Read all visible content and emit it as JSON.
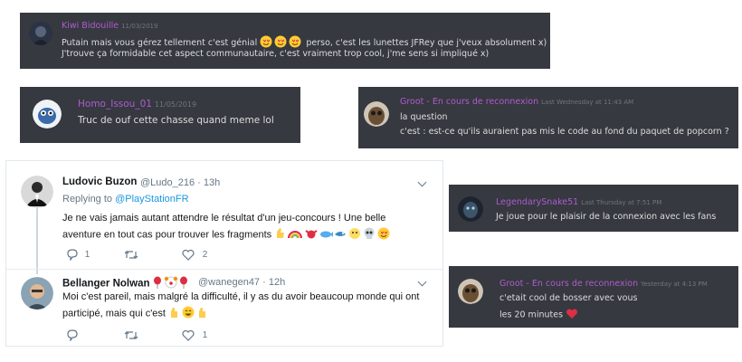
{
  "discord": {
    "kiwi": {
      "username": "Kiwi Bidouille",
      "timestamp": "11/03/2019",
      "line1_a": "Putain mais vous gérez tellement c'est génial",
      "line1_b": "perso, c'est les lunettes JFRey que j'veux absolument x)",
      "line2": "J'trouve ça formidable cet aspect communautaire, c'est vraiment trop cool, j'me sens si impliqué x)"
    },
    "homo": {
      "username": "Homo_Issou_01",
      "timestamp": "11/05/2019",
      "line1": "Truc de ouf cette chasse quand meme lol"
    },
    "groot1": {
      "username": "Groot - En cours de reconnexion",
      "timestamp": "Last Wednesday at 11:43 AM",
      "line1": "la question",
      "line2": "c'est : est-ce qu'ils auraient pas mis le code au fond du paquet de popcorn ?"
    },
    "legendary": {
      "username": "LegendarySnake51",
      "timestamp": "Last Thursday at 7:51 PM",
      "line1": "Je joue pour le plaisir de la connexion avec les fans"
    },
    "groot2": {
      "username": "Groot - En cours de reconnexion",
      "timestamp": "Yesterday at 4:13 PM",
      "line1": "c'etait cool de bosser avec vous",
      "line2": "les 20 minutes"
    }
  },
  "twitter": {
    "tweet1": {
      "name": "Ludovic Buzon",
      "handle": "@Ludo_216 · 13h",
      "replying_prefix": "Replying to",
      "replying_to": "@PlayStationFR",
      "line1": "Je ne vais jamais autant attendre le résultat d'un jeu-concours ! Une belle",
      "line2": "aventure en tout cas pour trouver les fragments",
      "reply_count": "1",
      "retweet_count": "",
      "like_count": "2"
    },
    "tweet2": {
      "name": "Bellanger Nolwan",
      "handle": "@wanegen47 · 12h",
      "line1": "Moi c'est pareil, mais malgré la difficulté, il  y as du avoir beaucoup monde qui ont",
      "line2": "participé, mais qui c'est",
      "reply_count": "",
      "retweet_count": "",
      "like_count": "1"
    }
  },
  "colors": {
    "discord_bg": "#36393f",
    "discord_username": "#b05ad1",
    "discord_text": "#dcddde",
    "discord_timestamp": "#72767d",
    "twitter_link": "#1b95e0",
    "twitter_muted": "#657786"
  },
  "icons": [
    "heart-eyes-emoji",
    "red-heart-emoji",
    "reply-icon",
    "retweet-icon",
    "like-icon",
    "chevron-down-icon"
  ]
}
